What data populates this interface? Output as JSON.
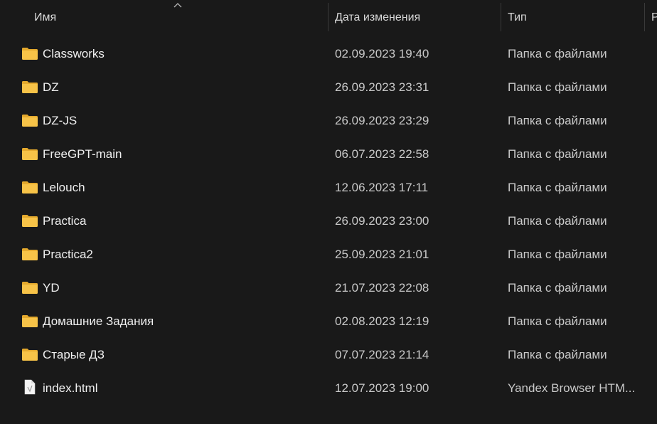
{
  "columns": {
    "name": "Имя",
    "date": "Дата изменения",
    "type": "Тип",
    "size": "Р"
  },
  "files": [
    {
      "name": "Classworks",
      "date": "02.09.2023 19:40",
      "type": "Папка с файлами",
      "icon": "folder-icon"
    },
    {
      "name": "DZ",
      "date": "26.09.2023 23:31",
      "type": "Папка с файлами",
      "icon": "folder-icon"
    },
    {
      "name": "DZ-JS",
      "date": "26.09.2023 23:29",
      "type": "Папка с файлами",
      "icon": "folder-icon"
    },
    {
      "name": "FreeGPT-main",
      "date": "06.07.2023 22:58",
      "type": "Папка с файлами",
      "icon": "folder-icon"
    },
    {
      "name": "Lelouch",
      "date": "12.06.2023 17:11",
      "type": "Папка с файлами",
      "icon": "folder-icon"
    },
    {
      "name": "Practica",
      "date": "26.09.2023 23:00",
      "type": "Папка с файлами",
      "icon": "folder-icon"
    },
    {
      "name": "Practica2",
      "date": "25.09.2023 21:01",
      "type": "Папка с файлами",
      "icon": "folder-icon"
    },
    {
      "name": "YD",
      "date": "21.07.2023 22:08",
      "type": "Папка с файлами",
      "icon": "folder-icon"
    },
    {
      "name": "Домашние Задания",
      "date": "02.08.2023 12:19",
      "type": "Папка с файлами",
      "icon": "folder-icon"
    },
    {
      "name": "Старые ДЗ",
      "date": "07.07.2023 21:14",
      "type": "Папка с файлами",
      "icon": "folder-icon"
    },
    {
      "name": "index.html",
      "date": "12.07.2023 19:00",
      "type": "Yandex Browser HTM...",
      "icon": "html-file-icon"
    }
  ],
  "colors": {
    "background": "#191919",
    "folder_body": "#f7c348",
    "folder_tab": "#e4a92d",
    "separator": "#3a3a3a"
  }
}
